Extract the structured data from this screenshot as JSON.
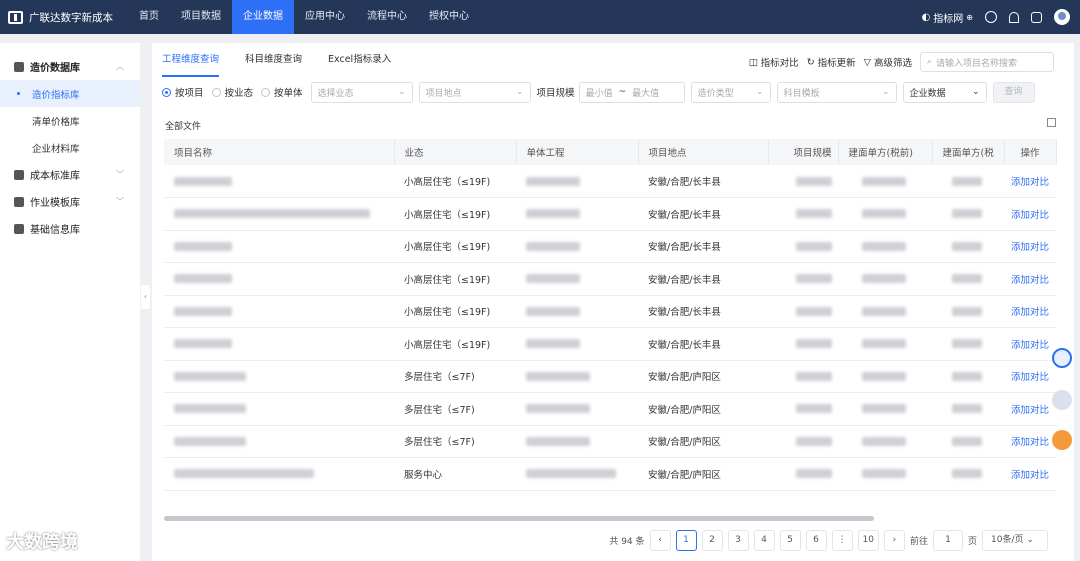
{
  "app": {
    "brand": "广联达数字新成本"
  },
  "nav": [
    "首页",
    "项目数据",
    "企业数据",
    "应用中心",
    "流程中心",
    "授权中心"
  ],
  "top_right": {
    "index_net": "指标网"
  },
  "sidebar": {
    "groups": [
      {
        "label": "造价数据库",
        "icon": "briefcase-icon",
        "items": [
          "造价指标库",
          "清单价格库",
          "企业材料库"
        ]
      },
      {
        "label": "成本标准库",
        "icon": "cube-icon",
        "items": []
      },
      {
        "label": "作业模板库",
        "icon": "template-icon",
        "items": []
      },
      {
        "label": "基础信息库",
        "icon": "database-icon",
        "items": []
      }
    ]
  },
  "tabs": [
    "工程维度查询",
    "科目维度查询",
    "Excel指标录入"
  ],
  "tools": {
    "compare": "指标对比",
    "update": "指标更新",
    "advanced": "高级筛选",
    "search_placeholder": "请输入项目名称搜索"
  },
  "filters": {
    "radios": [
      "按项目",
      "按业态",
      "按单体"
    ],
    "business_type": "选择业态",
    "location": "项目地点",
    "scale_label": "项目规模",
    "min": "最小值",
    "tilde": "~",
    "max": "最大值",
    "cost_type": "造价类型",
    "subject_template": "科目模板",
    "enterprise": "企业数据",
    "query": "查询"
  },
  "caption": "全部文件",
  "table": {
    "headers": [
      "项目名称",
      "业态",
      "单体工程",
      "项目地点",
      "项目规模",
      "建面单方(税前)",
      "建面单方(税",
      "操作"
    ],
    "rows": [
      {
        "type": "小高层住宅（≤19F)",
        "loc": "安徽/合肥/长丰县",
        "action": "添加对比"
      },
      {
        "type": "小高层住宅（≤19F)",
        "loc": "安徽/合肥/长丰县",
        "action": "添加对比"
      },
      {
        "type": "小高层住宅（≤19F)",
        "loc": "安徽/合肥/长丰县",
        "action": "添加对比"
      },
      {
        "type": "小高层住宅（≤19F)",
        "loc": "安徽/合肥/长丰县",
        "action": "添加对比"
      },
      {
        "type": "小高层住宅（≤19F)",
        "loc": "安徽/合肥/长丰县",
        "action": "添加对比"
      },
      {
        "type": "小高层住宅（≤19F)",
        "loc": "安徽/合肥/长丰县",
        "action": "添加对比"
      },
      {
        "type": "多层住宅（≤7F)",
        "loc": "安徽/合肥/庐阳区",
        "action": "添加对比"
      },
      {
        "type": "多层住宅（≤7F)",
        "loc": "安徽/合肥/庐阳区",
        "action": "添加对比"
      },
      {
        "type": "多层住宅（≤7F)",
        "loc": "安徽/合肥/庐阳区",
        "action": "添加对比"
      },
      {
        "type": "服务中心",
        "loc": "安徽/合肥/庐阳区",
        "action": "添加对比"
      }
    ]
  },
  "pagination": {
    "total": "共 94 条",
    "pages": [
      "1",
      "2",
      "3",
      "4",
      "5",
      "6",
      "⋮",
      "10"
    ],
    "current": "1",
    "goto": "前往",
    "goto_value": "1",
    "page_unit": "页",
    "page_size": "10条/页"
  },
  "watermark": "大数跨境"
}
